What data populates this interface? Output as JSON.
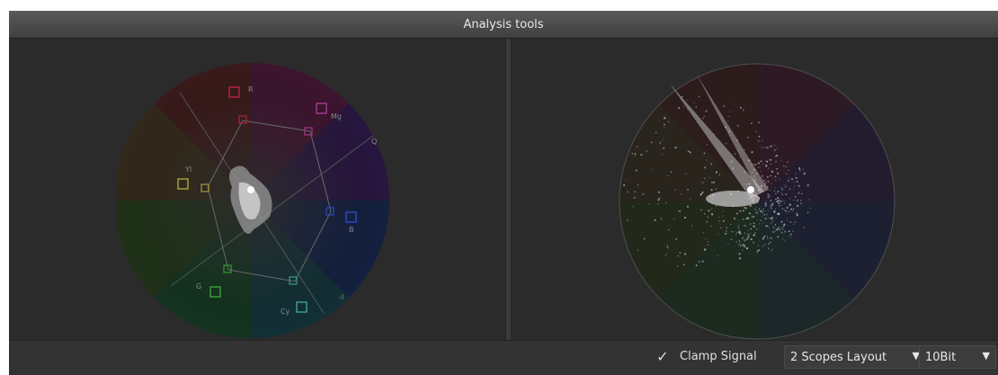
{
  "panel": {
    "title": "Analysis tools"
  },
  "vectorscope": {
    "targets": {
      "R": "R",
      "Mg": "Mg",
      "B": "B",
      "Cy": "Cy",
      "G": "G",
      "Yl": "Yl",
      "I": "-I",
      "Q": "Q"
    }
  },
  "colors": {
    "red": "#b02440",
    "magenta": "#a03a8a",
    "blue": "#2c48c0",
    "cyan": "#3a9a90",
    "green": "#3a9a3a",
    "yellow": "#a89a3a"
  },
  "footer": {
    "checkbox_mark": "✓",
    "clamp_label": "Clamp Signal",
    "layout_value": "2 Scopes Layout",
    "bit_value": "10Bit",
    "chevron": "▼"
  }
}
